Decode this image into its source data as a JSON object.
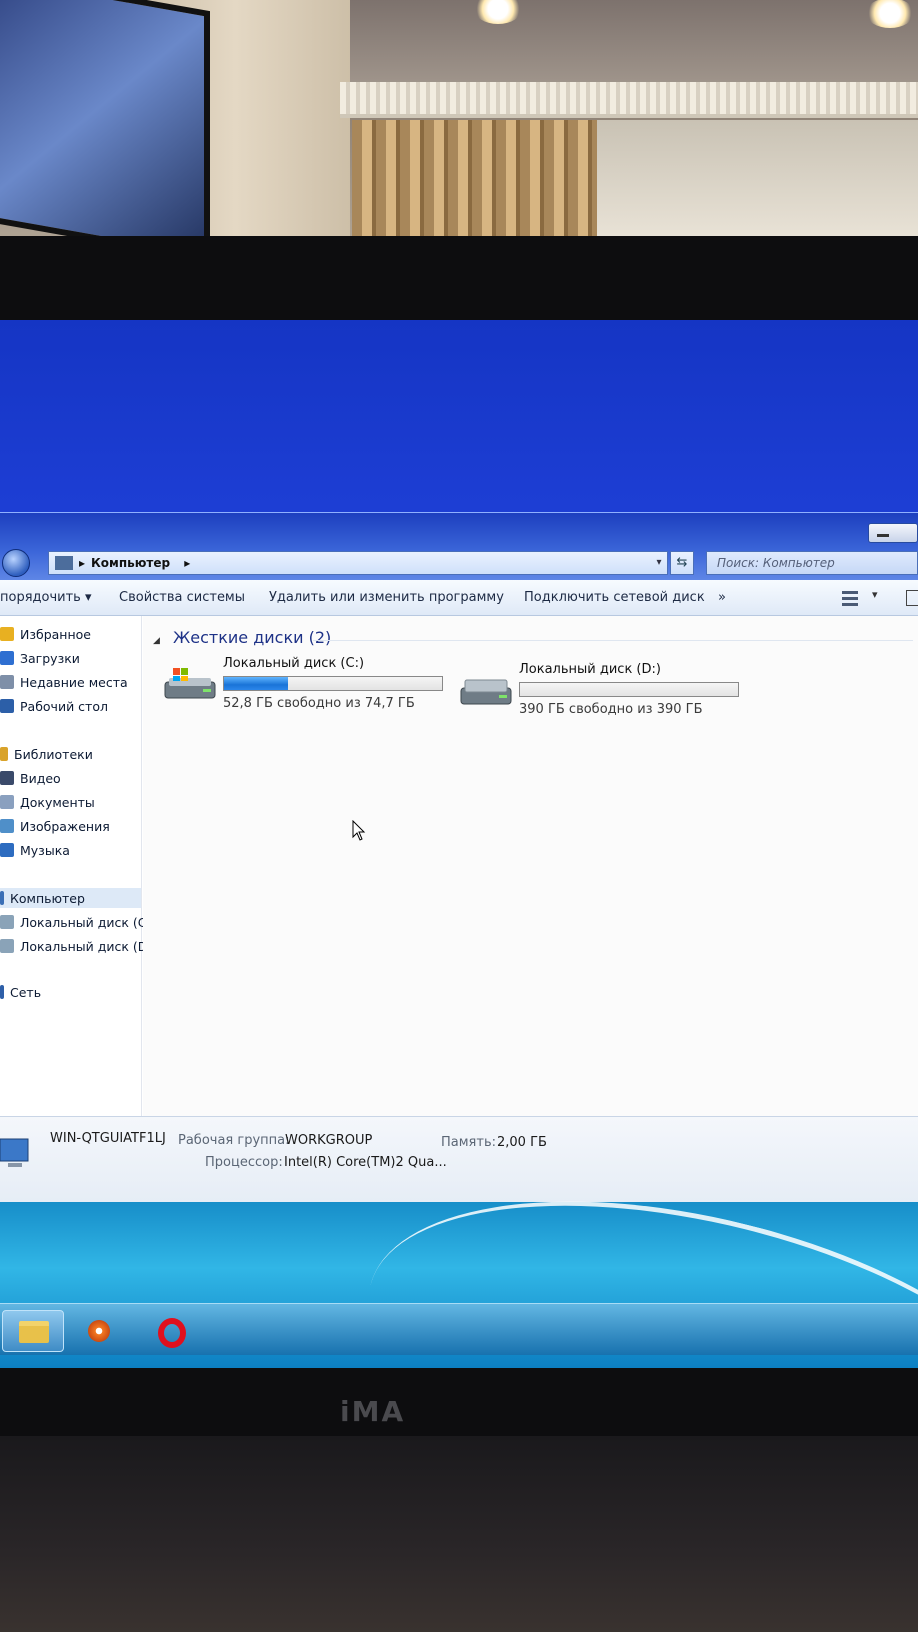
{
  "explorer": {
    "address": {
      "location": "Компьютер",
      "separator": "▸",
      "dropdown": "▾",
      "refresh_icon": "⇆",
      "search_placeholder": "Поиск: Компьютер"
    },
    "toolbar": {
      "organize": "порядочить ▾",
      "system_properties": "Свойства системы",
      "uninstall": "Удалить или изменить программу",
      "map_drive": "Подключить сетевой диск",
      "more": "»",
      "view_dropdown": "▾"
    },
    "navigation": {
      "favorites": [
        {
          "label": "Избранное",
          "icon": "star-icon",
          "color": "#e8b021"
        },
        {
          "label": "Загрузки",
          "icon": "downloads-folder-icon",
          "color": "#2e6fd1"
        },
        {
          "label": "Недавние места",
          "icon": "recent-places-icon",
          "color": "#7e8fa8"
        },
        {
          "label": "Рабочий стол",
          "icon": "desktop-icon",
          "color": "#2c5fa8"
        }
      ],
      "libraries": [
        {
          "label": "Библиотеки",
          "icon": "libraries-icon",
          "color": "#d9a32a"
        },
        {
          "label": "Видео",
          "icon": "video-icon",
          "color": "#3a4a6a"
        },
        {
          "label": "Документы",
          "icon": "documents-icon",
          "color": "#8aa0bf"
        },
        {
          "label": "Изображения",
          "icon": "pictures-icon",
          "color": "#4f8fc9"
        },
        {
          "label": "Музыка",
          "icon": "music-icon",
          "color": "#2d6cc0"
        }
      ],
      "computer": [
        {
          "label": "Компьютер",
          "icon": "computer-icon",
          "color": "#3b6fb6"
        },
        {
          "label": "Локальный диск (C",
          "icon": "drive-c-icon",
          "color": "#8aa3b8"
        },
        {
          "label": "Локальный диск (D",
          "icon": "drive-d-icon",
          "color": "#8aa3b8"
        }
      ],
      "network": [
        {
          "label": "Сеть",
          "icon": "network-icon",
          "color": "#2e5fa8"
        }
      ]
    },
    "content": {
      "group_title": "Жесткие диски (2)",
      "drives": [
        {
          "name": "Локальный диск (C:)",
          "free_text": "52,8 ГБ свободно из 74,7 ГБ",
          "used_fraction": 0.293,
          "icon": "system-drive-icon"
        },
        {
          "name": "Локальный диск (D:)",
          "free_text": "390 ГБ свободно из 390 ГБ",
          "used_fraction": 0.0,
          "icon": "drive-icon"
        }
      ]
    },
    "details": {
      "computer_name": "WIN-QTGUIATF1LJ",
      "workgroup_label": "Рабочая группа:",
      "workgroup_value": "WORKGROUP",
      "memory_label": "Память:",
      "memory_value": "2,00 ГБ",
      "cpu_label": "Процессор:",
      "cpu_value": "Intel(R) Core(TM)2 Qua..."
    }
  },
  "taskbar": {
    "items": [
      {
        "name": "explorer",
        "icon": "folder-icon"
      },
      {
        "name": "media-player",
        "icon": "media-player-icon"
      },
      {
        "name": "opera",
        "icon": "opera-icon"
      }
    ]
  },
  "monitor": {
    "brand": "iMA"
  },
  "colors": {
    "desktop_blue": "#1e3fd6",
    "drive_fill": "#1a74d8",
    "header_text": "#1e3287"
  }
}
